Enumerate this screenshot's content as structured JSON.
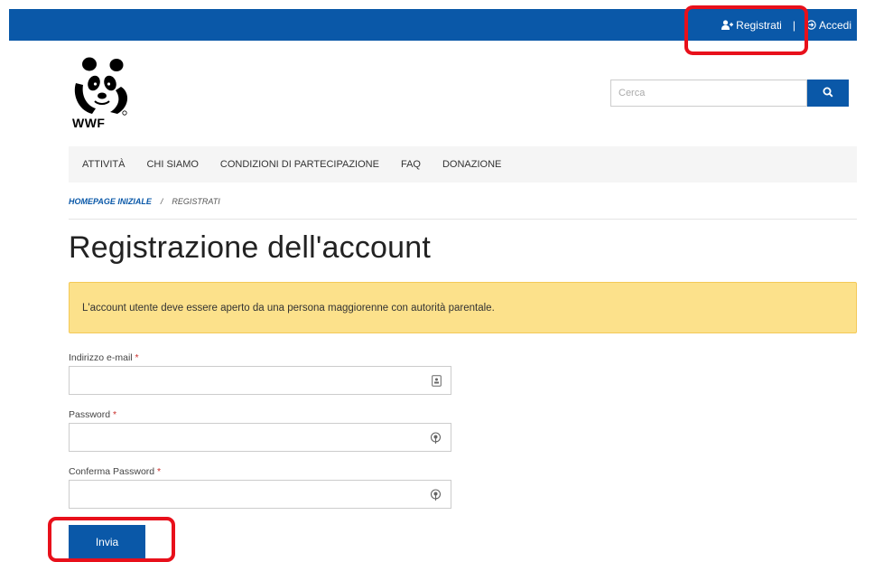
{
  "header": {
    "register_label": "Registrati",
    "separator": "|",
    "login_label": "Accedi"
  },
  "logo": {
    "text": "WWF"
  },
  "search": {
    "placeholder": "Cerca"
  },
  "nav": {
    "items": [
      {
        "label": "ATTIVITÀ"
      },
      {
        "label": "CHI SIAMO"
      },
      {
        "label": "CONDIZIONI DI PARTECIPAZIONE"
      },
      {
        "label": "FAQ"
      },
      {
        "label": "DONAZIONE"
      }
    ]
  },
  "breadcrumb": {
    "home": "HOMEPAGE INIZIALE",
    "separator": "/",
    "current": "REGISTRATI"
  },
  "page": {
    "title": "Registrazione dell'account"
  },
  "alert": {
    "text": "L'account utente deve essere aperto da una persona maggiorenne con autorità parentale."
  },
  "form": {
    "email_label": "Indirizzo e-mail",
    "password_label": "Password",
    "confirm_password_label": "Conferma Password",
    "required_mark": "*",
    "submit_label": "Invia"
  },
  "colors": {
    "brand_blue": "#0a58a8",
    "alert_yellow": "#fce18b",
    "highlight_red": "#e8101b"
  },
  "icons": {
    "register": "user-plus-icon",
    "login": "login-icon",
    "search": "search-icon",
    "email_field": "contact-card-icon",
    "password_field": "key-icon"
  }
}
